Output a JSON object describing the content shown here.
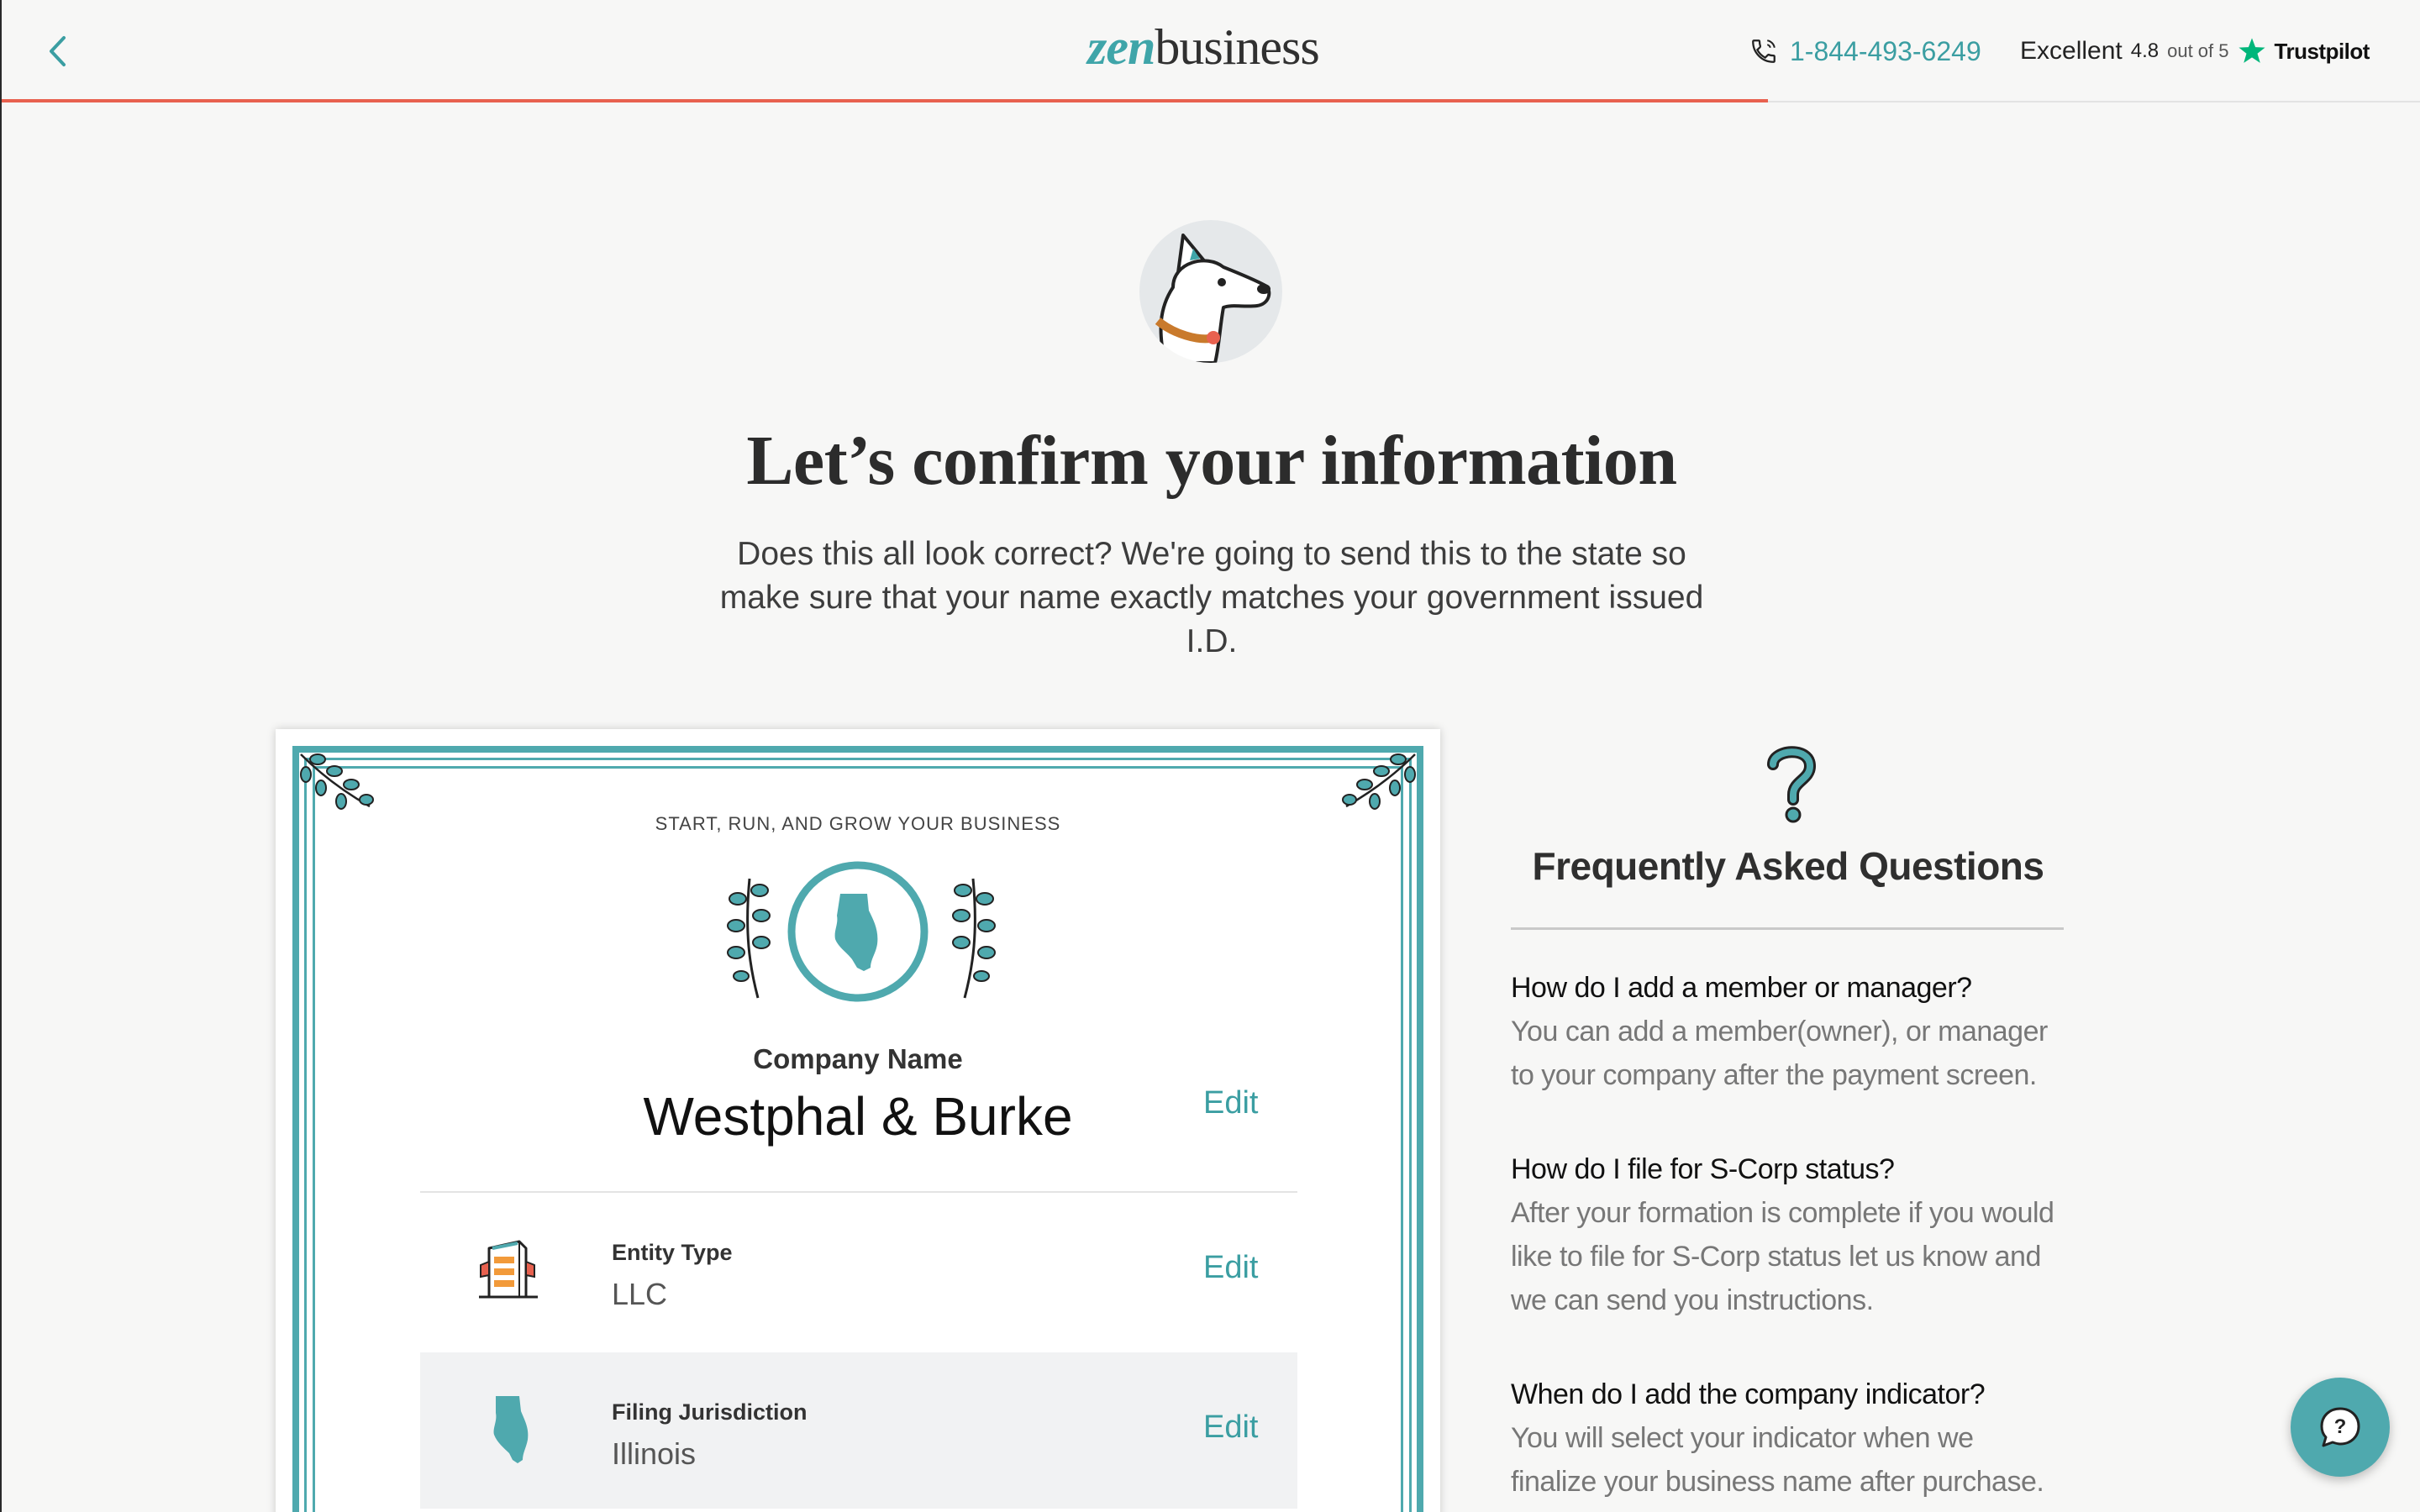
{
  "header": {
    "logo_zen": "zen",
    "logo_business": "business",
    "phone": "1-844-493-6249",
    "rating_word": "Excellent",
    "rating_value": "4.8",
    "rating_outof": "out of 5",
    "trustpilot": "Trustpilot",
    "progress_fraction": 0.73,
    "accent_color": "#e8614f",
    "brand_color": "#3fa5a9"
  },
  "hero": {
    "title": "Let’s confirm your information",
    "subtitle": "Does this all look correct? We're going to send this to the state so make sure that your name exactly matches your government issued I.D."
  },
  "certificate": {
    "tagline": "START, RUN, AND GROW YOUR BUSINESS",
    "company_label": "Company Name",
    "company_name": "Westphal & Burke",
    "edit_label": "Edit",
    "rows": [
      {
        "label": "Entity Type",
        "value": "LLC",
        "edit": "Edit",
        "icon": "building-icon"
      },
      {
        "label": "Filing Jurisdiction",
        "value": "Illinois",
        "edit": "Edit",
        "icon": "illinois-state-icon"
      }
    ]
  },
  "faq": {
    "title": "Frequently Asked Questions",
    "items": [
      {
        "q": "How do I add a member or manager?",
        "a": "You can add a member(owner), or manager to your company after the payment screen."
      },
      {
        "q": "How do I file for S-Corp status?",
        "a": "After your formation is complete if you would like to file for S-Corp status let us know and we can send you instructions."
      },
      {
        "q": "When do I add the company indicator?",
        "a": "You will select your indicator when we finalize your business name after purchase."
      }
    ]
  }
}
